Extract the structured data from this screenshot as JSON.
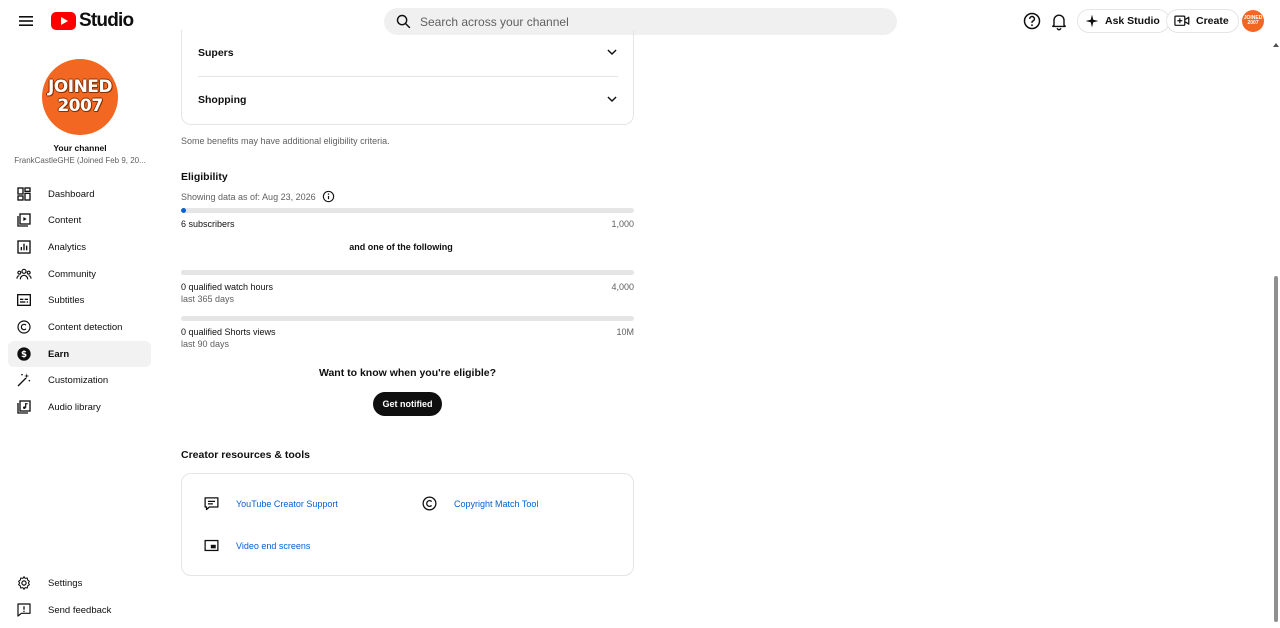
{
  "header": {
    "logo_text": "Studio",
    "search_placeholder": "Search across your channel",
    "ask_studio_label": "Ask Studio",
    "create_label": "Create",
    "avatar_text_line1": "JOINED",
    "avatar_text_line2": "2007",
    "brand_color": "#ff0000"
  },
  "sidebar": {
    "avatar_line1": "JOINED",
    "avatar_line2": "2007",
    "your_channel": "Your channel",
    "channel_name": "FrankCastleGHE (Joined Feb 9, 20...",
    "items": [
      {
        "label": "Dashboard",
        "icon": "dashboard-icon"
      },
      {
        "label": "Content",
        "icon": "content-icon"
      },
      {
        "label": "Analytics",
        "icon": "analytics-icon"
      },
      {
        "label": "Community",
        "icon": "community-icon"
      },
      {
        "label": "Subtitles",
        "icon": "subtitles-icon"
      },
      {
        "label": "Content detection",
        "icon": "copyright-icon"
      },
      {
        "label": "Earn",
        "icon": "dollar-icon",
        "active": true
      },
      {
        "label": "Customization",
        "icon": "magic-wand-icon"
      },
      {
        "label": "Audio library",
        "icon": "audio-library-icon"
      }
    ],
    "bottom_items": [
      {
        "label": "Settings",
        "icon": "gear-icon"
      },
      {
        "label": "Send feedback",
        "icon": "feedback-icon"
      }
    ]
  },
  "benefits": {
    "rows": [
      {
        "title": "Supers"
      },
      {
        "title": "Shopping"
      }
    ],
    "note": "Some benefits may have additional eligibility criteria."
  },
  "eligibility": {
    "title": "Eligibility",
    "showing": "Showing data as of: Aug 23, 2026",
    "and_one": "and one of the following",
    "metrics": [
      {
        "label": "6 subscribers",
        "target": "1,000",
        "sub": "",
        "progress": 0.006
      },
      {
        "label": "0 qualified watch hours",
        "target": "4,000",
        "sub": "last 365 days",
        "progress": 0
      },
      {
        "label": "0 qualified Shorts views",
        "target": "10M",
        "sub": "last 90 days",
        "progress": 0
      }
    ],
    "want_to_know": "Want to know when you're eligible?",
    "notify_label": "Get notified"
  },
  "resources": {
    "title": "Creator resources & tools",
    "links": [
      {
        "label": "YouTube Creator Support",
        "icon": "support-chat-icon"
      },
      {
        "label": "Copyright Match Tool",
        "icon": "copyright-icon"
      },
      {
        "label": "Video end screens",
        "icon": "end-screen-icon"
      }
    ]
  }
}
